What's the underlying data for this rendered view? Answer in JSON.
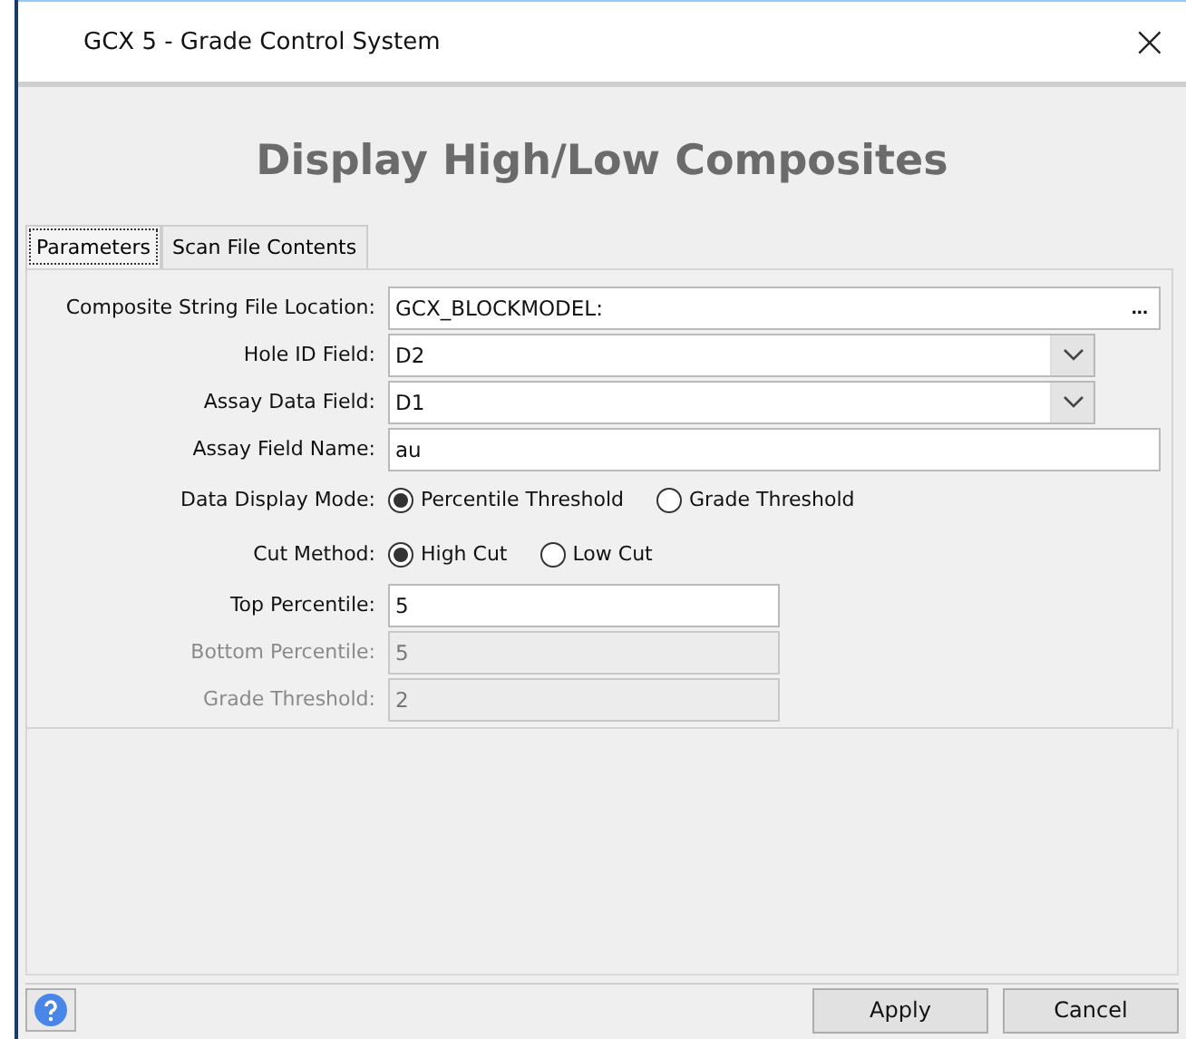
{
  "window": {
    "title": "GCX 5 - Grade Control System",
    "close": "×"
  },
  "heading": "Display High/Low Composites",
  "tabs": [
    {
      "label": "Parameters",
      "selected": true
    },
    {
      "label": "Scan File Contents",
      "selected": false
    }
  ],
  "fields": [
    {
      "kind": "browse",
      "label": "Composite String File Location:",
      "value": "GCX_BLOCKMODEL:",
      "button": "...",
      "disabled": false
    },
    {
      "kind": "combo",
      "label": "Hole ID Field:",
      "value": "D2",
      "disabled": false
    },
    {
      "kind": "combo",
      "label": "Assay Data Field:",
      "value": "D1",
      "disabled": false
    },
    {
      "kind": "text",
      "label": "Assay Field Name:",
      "value": "au",
      "disabled": false
    },
    {
      "kind": "radio",
      "label": "Data Display Mode:",
      "disabled": false,
      "options": [
        {
          "label": "Percentile Threshold",
          "selected": true
        },
        {
          "label": "Grade Threshold",
          "selected": false
        }
      ]
    },
    {
      "kind": "radio",
      "label": "Cut Method:",
      "disabled": false,
      "options": [
        {
          "label": "High Cut",
          "selected": true
        },
        {
          "label": "Low Cut",
          "selected": false
        }
      ]
    },
    {
      "kind": "short",
      "label": "Top Percentile:",
      "value": "5",
      "disabled": false
    },
    {
      "kind": "short",
      "label": "Bottom Percentile:",
      "value": "5",
      "disabled": true
    },
    {
      "kind": "short",
      "label": "Grade Threshold:",
      "value": "2",
      "disabled": true
    }
  ],
  "buttons": [
    "Apply",
    "Cancel"
  ]
}
